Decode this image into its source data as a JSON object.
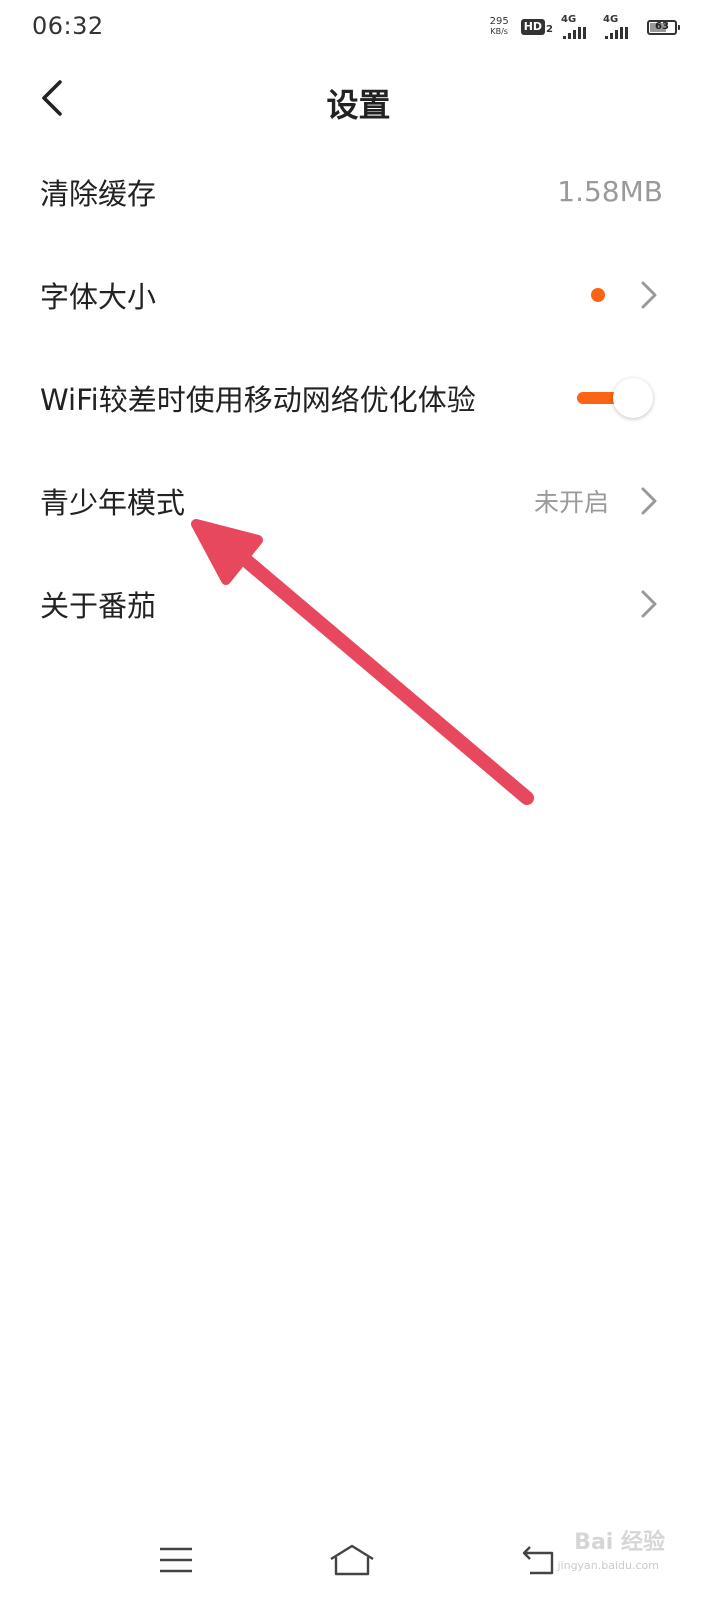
{
  "status_bar": {
    "time": "06:32",
    "net_speed_value": "295",
    "net_speed_unit": "KB/s",
    "hd_label": "HD",
    "hd_sub": "2",
    "signal_1_label": "4G",
    "signal_2_label": "4G",
    "battery_level": "63",
    "icons": [
      "hd-icon",
      "signal-4g-icon",
      "signal-4g-icon",
      "battery-icon"
    ]
  },
  "header": {
    "back_icon": "chevron-left-icon",
    "title": "设置"
  },
  "settings": {
    "clear_cache": {
      "label": "清除缓存",
      "value": "1.58MB"
    },
    "font_size": {
      "label": "字体大小",
      "indicator_color": "#fa6414"
    },
    "wifi_optimize": {
      "label": "WiFi较差时使用移动网络优化体验",
      "enabled": true
    },
    "teen_mode": {
      "label": "青少年模式",
      "value": "未开启"
    },
    "about": {
      "label": "关于番茄"
    }
  },
  "annotation": {
    "color": "#e8485e"
  },
  "nav_bar": {
    "icons": [
      "menu-icon",
      "home-icon",
      "back-icon"
    ]
  },
  "watermark": {
    "text": "Bai 经验",
    "sub": "jingyan.baidu.com"
  },
  "colors": {
    "accent": "#fa6414",
    "secondary_text": "#9a9a9a",
    "chevron": "#999999"
  }
}
